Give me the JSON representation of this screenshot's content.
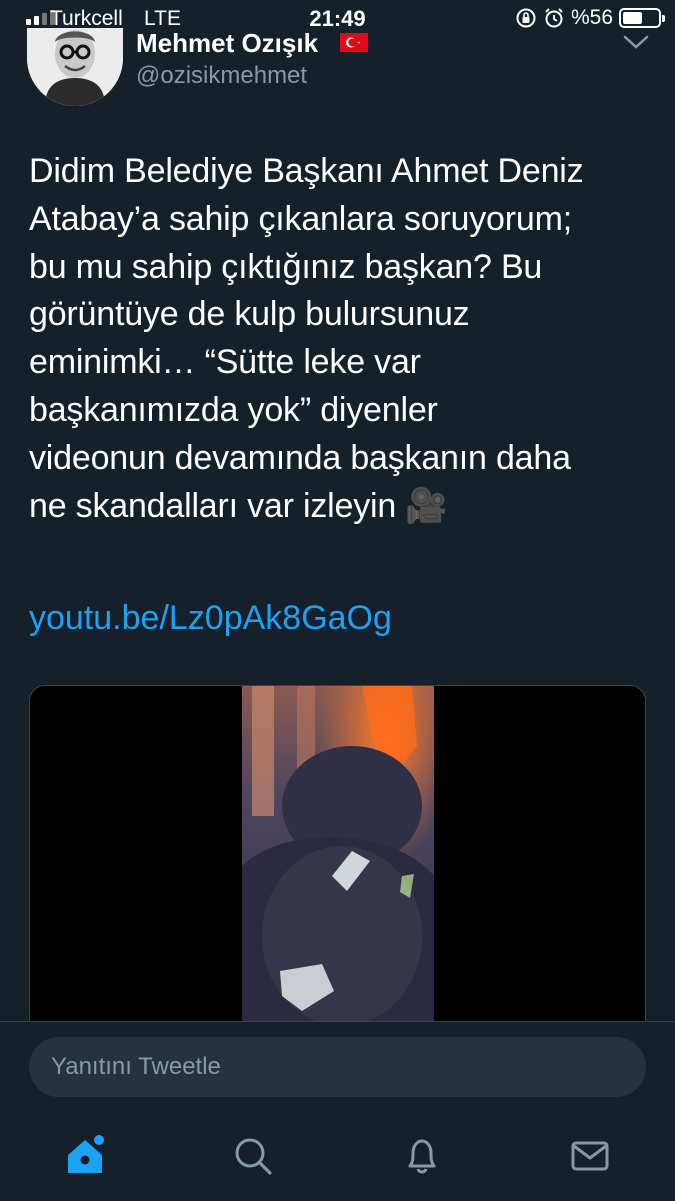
{
  "status_bar": {
    "carrier": "Turkcell",
    "network": "LTE",
    "time": "21:49",
    "battery_text": "%56",
    "battery_level": 0.56
  },
  "tweet": {
    "author_name": "Mehmet Ozışık",
    "handle": "@ozisikmehmet",
    "flag_icon": "turkey-flag-icon",
    "text": "Didim Belediye Başkanı Ahmet Deniz\nAtabay’a sahip çıkanlara soruyorum;\nbu mu sahip çıktığınız başkan? Bu\ngörüntüye de kulp bulursunuz\neminimki… “Sütte leke var\nbaşkanımızda yok” diyenler\nvideonun devamında başkanın daha\nne skandalları var izleyin 🎥",
    "link": "youtu.be/Lz0pAk8GaOg"
  },
  "reply": {
    "placeholder": "Yanıtını Tweetle"
  },
  "tabs": [
    {
      "icon": "home-icon"
    },
    {
      "icon": "search-icon"
    },
    {
      "icon": "bell-icon"
    },
    {
      "icon": "mail-icon"
    }
  ],
  "colors": {
    "background": "#15202b",
    "accent": "#1da1f2",
    "secondary_text": "#8899a6",
    "reply_field": "#253341"
  }
}
